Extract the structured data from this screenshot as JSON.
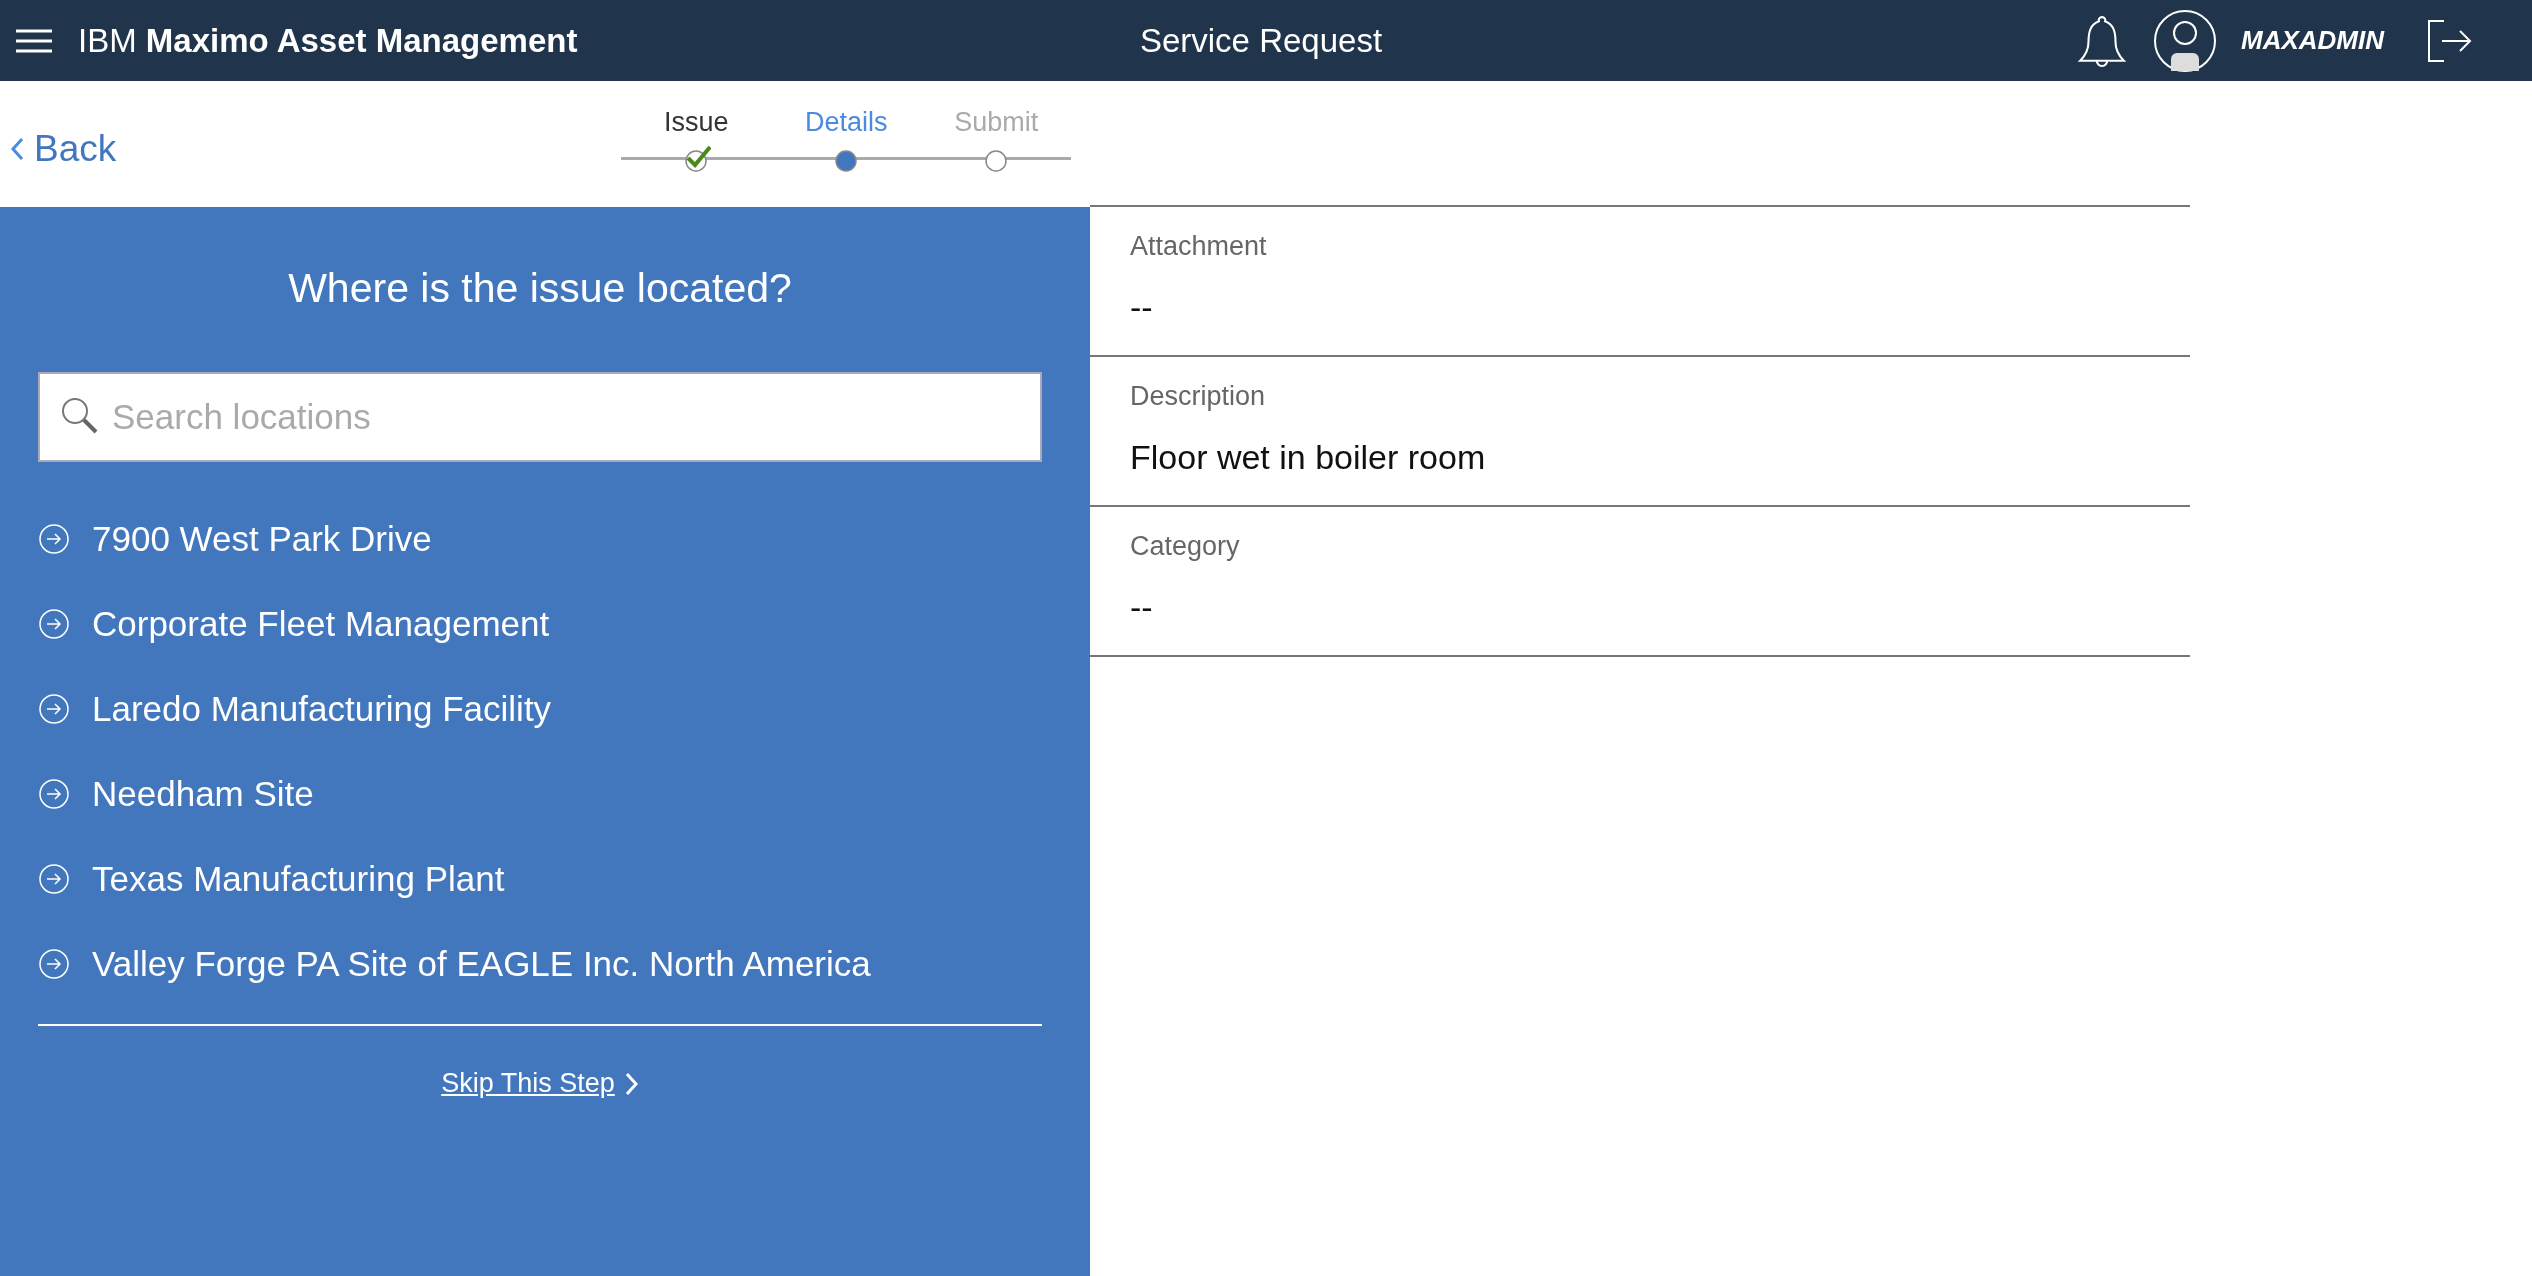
{
  "header": {
    "app_title": "IBM **Maximo Asset Management**",
    "page_title": "Service Request",
    "user": "MAXADMIN"
  },
  "back_link": "Back",
  "steps": [
    {
      "label": "Issue",
      "completed": true,
      "selected": false
    },
    {
      "label": "Details",
      "completed": false,
      "selected": true
    },
    {
      "label": "Submit",
      "completed": false,
      "selected": false
    }
  ],
  "location_panel": {
    "question": "Where is the issue located?",
    "search": {
      "placeholder": "Search locations"
    },
    "locations": [
      "7900 West Park Drive",
      "Corporate Fleet Management",
      "Laredo Manufacturing Facility",
      "Needham Site",
      "Texas Manufacturing Plant",
      "Valley Forge PA Site of EAGLE Inc. North America"
    ],
    "skip_link": "Skip This Step"
  },
  "fields": [
    {
      "label": "Attachment",
      "value": "--"
    },
    {
      "label": "Description",
      "value": "Floor wet in boiler room"
    },
    {
      "label": "Category",
      "value": "--"
    }
  ]
}
